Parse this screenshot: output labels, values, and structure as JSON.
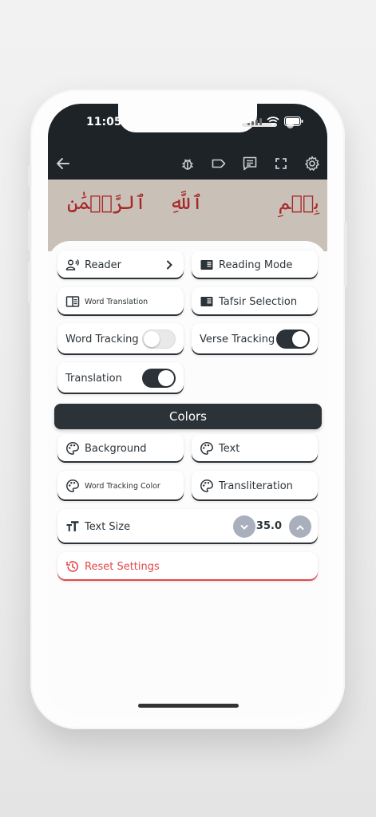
{
  "status_bar": {
    "time": "11:05"
  },
  "toolbar": {
    "back_icon": "arrow-left-icon",
    "icons": [
      "bug-icon",
      "label-icon",
      "comment-text-icon",
      "fullscreen-icon",
      "gear-icon"
    ]
  },
  "mushaf": {
    "words": [
      "بِسۡمِ",
      "ٱللَّهِ",
      "ٱلرَّحۡمَٰنِ"
    ],
    "text_color": "#a8282a"
  },
  "settings": {
    "reader_label": "Reader",
    "reading_mode_label": "Reading Mode",
    "word_translation_label": "Word Translation",
    "tafsir_selection_label": "Tafsir Selection",
    "word_tracking_label": "Word Tracking",
    "word_tracking_on": false,
    "verse_tracking_label": "Verse Tracking",
    "verse_tracking_on": true,
    "translation_label": "Translation",
    "translation_on": true
  },
  "colors": {
    "header": "Colors",
    "background_label": "Background",
    "text_label": "Text",
    "word_tracking_color_label": "Word Tracking Color",
    "transliteration_label": "Transliteration"
  },
  "text_size": {
    "label": "Text Size",
    "value": "35.0"
  },
  "reset": {
    "label": "Reset Settings"
  },
  "theme": {
    "dark": "#2b3238",
    "danger": "#e2474a",
    "stepper": "#a9afbd"
  }
}
